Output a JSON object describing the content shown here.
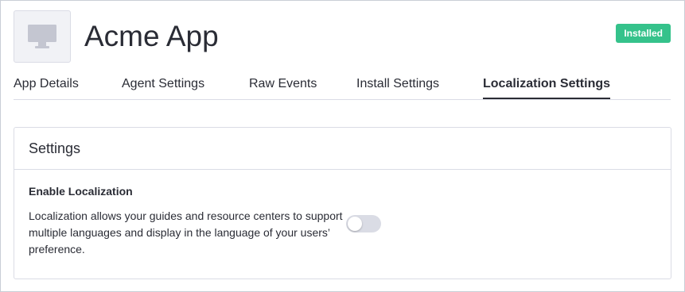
{
  "app": {
    "name": "Acme App",
    "status": "Installed",
    "icon": "monitor-icon"
  },
  "tabs": [
    {
      "label": "App Details",
      "active": false
    },
    {
      "label": "Agent Settings",
      "active": false
    },
    {
      "label": "Raw Events",
      "active": false
    },
    {
      "label": "Install Settings",
      "active": false
    },
    {
      "label": "Localization Settings",
      "active": true
    }
  ],
  "settings_card": {
    "title": "Settings",
    "enable_localization": {
      "label": "Enable Localization",
      "description": "Localization allows your guides and resource centers to support multiple languages and display in the language of your users’ preference.",
      "enabled": false
    }
  },
  "colors": {
    "badge": "#35c28b",
    "text": "#2a2c35",
    "border": "#dadce5",
    "toggle_off": "#dadce5"
  }
}
